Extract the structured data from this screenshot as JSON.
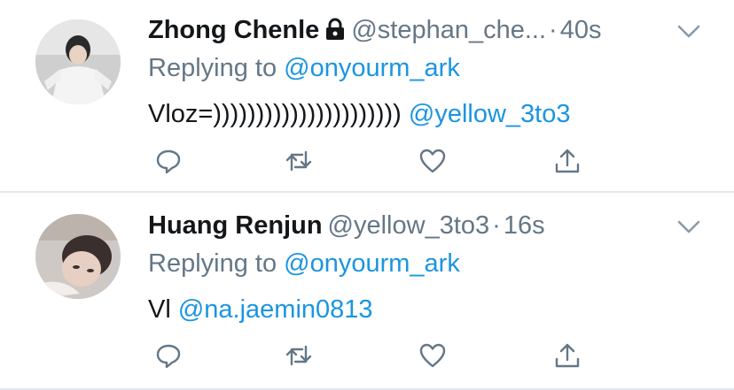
{
  "tweets": [
    {
      "name": "Zhong Chenle",
      "protected": true,
      "handle": "@stephan_che...",
      "dot": "·",
      "time": "40s",
      "replying_prefix": "Replying to",
      "replying_handle": "@onyourm_ark",
      "text": "Vloz=))))))))))))))))))))))",
      "text_mention": "@yellow_3to3"
    },
    {
      "name": "Huang Renjun",
      "protected": false,
      "handle": "@yellow_3to3",
      "dot": "·",
      "time": "16s",
      "replying_prefix": "Replying to",
      "replying_handle": "@onyourm_ark",
      "text": "Vl",
      "text_mention": "@na.jaemin0813"
    }
  ],
  "icons": [
    "lock-icon",
    "chevron-down-icon",
    "reply-icon",
    "retweet-icon",
    "like-icon",
    "share-icon"
  ],
  "colors": {
    "text": "#14171a",
    "secondary": "#657786",
    "link": "#1b95e0",
    "divider": "#e1e8ed"
  }
}
